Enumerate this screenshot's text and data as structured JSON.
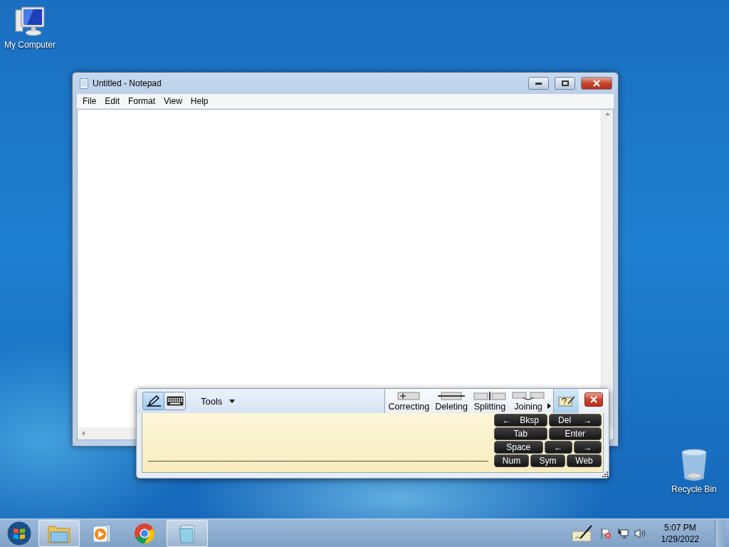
{
  "desktop_icons": [
    {
      "kind": "computer",
      "label": "My Computer"
    },
    {
      "kind": "recycle-bin",
      "label": "Recycle Bin"
    }
  ],
  "notepad": {
    "title": "Untitled - Notepad",
    "menu": [
      "File",
      "Edit",
      "Format",
      "View",
      "Help"
    ]
  },
  "input_panel": {
    "modes": [
      {
        "kind": "pen",
        "selected": true
      },
      {
        "kind": "keyboard",
        "selected": false
      }
    ],
    "tools": "Tools",
    "gestures": [
      {
        "kind": "correcting",
        "label": "Correcting"
      },
      {
        "kind": "deleting",
        "label": "Deleting"
      },
      {
        "kind": "splitting",
        "label": "Splitting"
      },
      {
        "kind": "joining",
        "label": "Joining"
      }
    ],
    "keys": [
      [
        {
          "kind": "wide",
          "parts": [
            "←",
            "Bksp"
          ]
        },
        {
          "kind": "wide",
          "parts": [
            "Del",
            "→"
          ]
        }
      ],
      [
        {
          "kind": "wide",
          "parts": [
            "Tab"
          ]
        },
        {
          "kind": "wide",
          "parts": [
            "Enter"
          ]
        }
      ],
      [
        {
          "kind": "wide",
          "parts": [
            "Space"
          ]
        },
        {
          "kind": "narrow",
          "parts": [
            "←"
          ]
        },
        {
          "kind": "narrow",
          "parts": [
            "→"
          ]
        }
      ],
      [
        {
          "kind": "wide",
          "parts": [
            "Num"
          ]
        },
        {
          "kind": "wide",
          "parts": [
            "Sym"
          ]
        },
        {
          "kind": "wide",
          "parts": [
            "Web"
          ]
        }
      ]
    ]
  },
  "taskbar": {
    "apps": [
      {
        "kind": "explorer",
        "running": true
      },
      {
        "kind": "media",
        "running": false
      },
      {
        "kind": "browser",
        "running": false
      },
      {
        "kind": "notepad",
        "running": true
      }
    ],
    "tray": [
      {
        "kind": "pen"
      },
      {
        "kind": "flag"
      },
      {
        "kind": "network"
      },
      {
        "kind": "volume"
      }
    ],
    "time": "5:07 PM",
    "date": "1/29/2022"
  }
}
